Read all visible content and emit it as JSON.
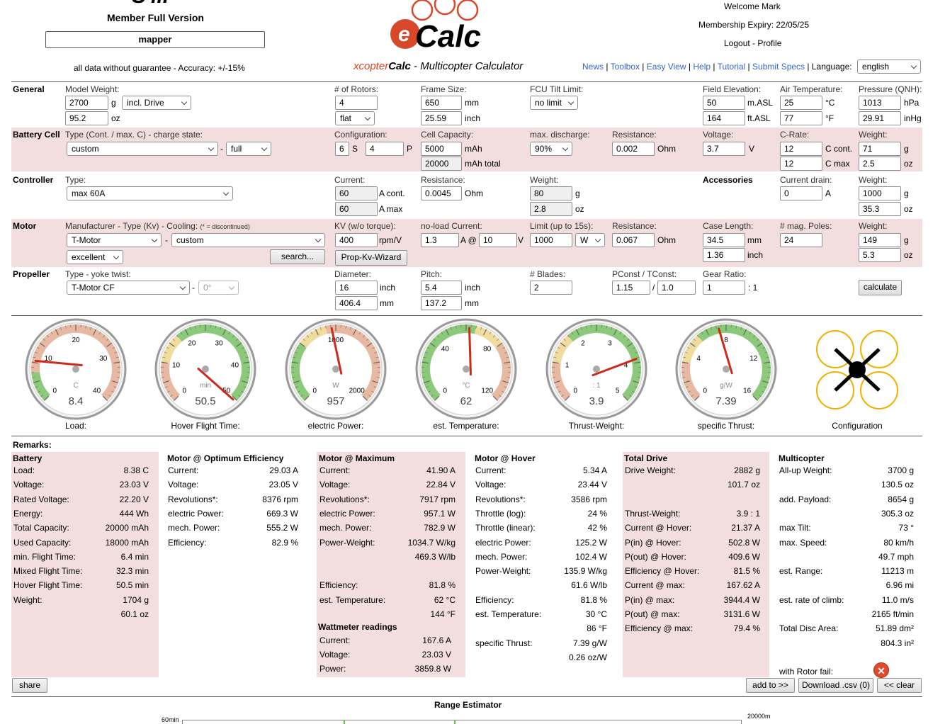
{
  "header": {
    "logo_text": "S'ill",
    "member": "Member Full Version",
    "username": "mapper",
    "disclaimer": "all data without guarantee - Accuracy: +/-15%",
    "brand_prefix": "xcopter",
    "brand_calc": "Calc",
    "brand_suffix": " - Multicopter Calculator",
    "welcome": "Welcome Mark",
    "membership": "Membership Expiry: 22/05/25",
    "logout": "Logout",
    "sep": " - ",
    "profile": "Profile",
    "links": [
      "News",
      "Toolbox",
      "Easy View",
      "Help",
      "Tutorial",
      "Submit Specs"
    ],
    "language_label": "Language:",
    "language": "english"
  },
  "general": {
    "title": "General",
    "weight_label": "Model Weight:",
    "weight_g": "2700",
    "unit_g": "g",
    "drive_select": "incl. Drive",
    "weight_oz": "95.2",
    "unit_oz": "oz",
    "rotors_label": "# of Rotors:",
    "rotors": "4",
    "layout": "flat",
    "frame_label": "Frame Size:",
    "frame_mm": "650",
    "unit_mm": "mm",
    "frame_inch": "25.59",
    "unit_inch": "inch",
    "tilt_label": "FCU Tilt Limit:",
    "tilt": "no limit",
    "elev_label": "Field Elevation:",
    "elev_m": "50",
    "unit_masl": "m.ASL",
    "elev_ft": "164",
    "unit_ftasl": "ft.ASL",
    "temp_label": "Air Temperature:",
    "temp_c": "25",
    "unit_c": "°C",
    "temp_f": "77",
    "unit_f": "°F",
    "qnh_label": "Pressure (QNH):",
    "qnh_hpa": "1013",
    "unit_hpa": "hPa",
    "qnh_inhg": "29.91",
    "unit_inhg": "inHg"
  },
  "battery": {
    "title": "Battery Cell",
    "type_label": "Type (Cont. / max. C) - charge state:",
    "type": "custom",
    "dash": "-",
    "charge": "full",
    "config_label": "Configuration:",
    "s": "6",
    "unit_s": "S",
    "p": "4",
    "unit_p": "P",
    "cap_label": "Cell Capacity:",
    "cap": "5000",
    "unit_mah": "mAh",
    "cap_total": "20000",
    "unit_mah_total": "mAh total",
    "disch_label": "max. discharge:",
    "disch": "90%",
    "res_label": "Resistance:",
    "res": "0.002",
    "unit_ohm": "Ohm",
    "volt_label": "Voltage:",
    "volt": "3.7",
    "unit_v": "V",
    "crate_label": "C-Rate:",
    "c_cont": "12",
    "unit_ccont": "C cont.",
    "c_max": "12",
    "unit_cmax": "C max",
    "weight_label": "Weight:",
    "w_g": "71",
    "unit_g": "g",
    "w_oz": "2.5",
    "unit_oz": "oz"
  },
  "controller": {
    "title": "Controller",
    "type_label": "Type:",
    "type": "max 60A",
    "cur_label": "Current:",
    "cur_cont": "60",
    "unit_acont": "A cont.",
    "cur_max": "60",
    "unit_amax": "A max",
    "res_label": "Resistance:",
    "res": "0.0045",
    "unit_ohm": "Ohm",
    "weight_label": "Weight:",
    "w_g": "80",
    "unit_g": "g",
    "w_oz": "2.8",
    "unit_oz": "oz",
    "acc_title": "Accessories",
    "drain_label": "Current drain:",
    "drain": "0",
    "unit_a": "A",
    "acc_w_label": "Weight:",
    "acc_w_g": "1000",
    "acc_unit_g": "g",
    "acc_w_oz": "35.3",
    "acc_unit_oz": "oz"
  },
  "motor": {
    "title": "Motor",
    "mfr_label": "Manufacturer - Type (Kv) - Cooling:",
    "mfr_note": "(* = discontinued)",
    "mfr": "T-Motor",
    "dash": "-",
    "type": "custom",
    "cooling": "excellent",
    "search": "search...",
    "kv_label": "KV (w/o torque):",
    "kv": "400",
    "unit_rpmv": "rpm/V",
    "wizard": "Prop-Kv-Wizard",
    "nl_label": "no-load Current:",
    "nl_a": "1.3",
    "unit_a_at": "A @",
    "nl_v": "10",
    "unit_v": "V",
    "limit_label": "Limit (up to 15s):",
    "limit": "1000",
    "limit_unit": "W",
    "res_label": "Resistance:",
    "res": "0.067",
    "unit_ohm": "Ohm",
    "case_label": "Case Length:",
    "case_mm": "34.5",
    "unit_mm": "mm",
    "case_inch": "1.36",
    "unit_inch": "inch",
    "poles_label": "# mag. Poles:",
    "poles": "24",
    "weight_label": "Weight:",
    "w_g": "149",
    "unit_g": "g",
    "w_oz": "5.3",
    "unit_oz": "oz"
  },
  "propeller": {
    "title": "Propeller",
    "type_label": "Type - yoke twist:",
    "type": "T-Motor CF",
    "dash": "-",
    "twist": "0°",
    "dia_label": "Diameter:",
    "dia_in": "16",
    "unit_inch": "inch",
    "dia_mm": "406.4",
    "unit_mm": "mm",
    "pitch_label": "Pitch:",
    "pitch_in": "5.4",
    "unit_pinch": "inch",
    "pitch_mm": "137.2",
    "unit_pmm": "mm",
    "blades_label": "# Blades:",
    "blades": "2",
    "pconst_label": "PConst / TConst:",
    "pconst": "1.15",
    "slash": "/",
    "tconst": "1.0",
    "gear_label": "Gear Ratio:",
    "gear": "1",
    "gear_unit": ": 1",
    "calculate": "calculate"
  },
  "gauges": [
    {
      "label": "Load:",
      "value": "8.4",
      "unit": "C",
      "ticks": [
        "0",
        "10",
        "20",
        "30",
        "40"
      ],
      "min": 0,
      "max": 40,
      "reading": 8.38,
      "zones": [
        [
          "#8cc97a",
          0,
          0.15
        ],
        [
          "#e8b9a2",
          0.15,
          1
        ]
      ]
    },
    {
      "label": "Hover Flight Time:",
      "value": "50.5",
      "unit": "min",
      "ticks": [
        "0",
        "10",
        "20",
        "30",
        "40",
        "50"
      ],
      "min": 0,
      "max": 50,
      "reading": 50.5,
      "zones": [
        [
          "#e8b9a2",
          0,
          0.2
        ],
        [
          "#f1dca0",
          0.2,
          0.35
        ],
        [
          "#8cc97a",
          0.35,
          1
        ]
      ]
    },
    {
      "label": "electric Power:",
      "value": "957",
      "unit": "W",
      "ticks": [
        "0",
        "1000",
        "2000"
      ],
      "min": 0,
      "max": 2000,
      "reading": 957,
      "zones": [
        [
          "#8cc97a",
          0,
          0.3
        ],
        [
          "#f1dca0",
          0.3,
          0.45
        ],
        [
          "#e8b9a2",
          0.45,
          1
        ]
      ]
    },
    {
      "label": "est. Temperature:",
      "value": "62",
      "unit": "°C",
      "ticks": [
        "0",
        "40",
        "80",
        "120"
      ],
      "min": 0,
      "max": 120,
      "reading": 62,
      "zones": [
        [
          "#8cc97a",
          0,
          0.55
        ],
        [
          "#f1dca0",
          0.55,
          0.7
        ],
        [
          "#e8b9a2",
          0.7,
          1
        ]
      ]
    },
    {
      "label": "Thrust-Weight:",
      "value": "3.9",
      "unit": ": 1",
      "ticks": [
        "0",
        "1",
        "2",
        "3",
        "4",
        "5"
      ],
      "min": 0,
      "max": 5,
      "reading": 3.9,
      "zones": [
        [
          "#e8b9a2",
          0,
          0.2
        ],
        [
          "#f1dca0",
          0.2,
          0.35
        ],
        [
          "#8cc97a",
          0.35,
          1
        ]
      ]
    },
    {
      "label": "specific Thrust:",
      "value": "7.39",
      "unit": "g/W",
      "ticks": [
        "0",
        "4",
        "8",
        "12",
        "16"
      ],
      "min": 0,
      "max": 16,
      "reading": 7.39,
      "zones": [
        [
          "#e8b9a2",
          0,
          0.2
        ],
        [
          "#f1dca0",
          0.2,
          0.35
        ],
        [
          "#8cc97a",
          0.35,
          1
        ]
      ]
    }
  ],
  "config_label": "Configuration",
  "remarks": "Remarks:",
  "results": {
    "battery": {
      "title": "Battery",
      "rows": [
        [
          "Load:",
          "8.38 C"
        ],
        [
          "Voltage:",
          "23.03 V"
        ],
        [
          "Rated Voltage:",
          "22.20 V"
        ],
        [
          "Energy:",
          "444 Wh"
        ],
        [
          "Total Capacity:",
          "20000 mAh"
        ],
        [
          "Used Capacity:",
          "18000 mAh"
        ],
        [
          "min. Flight Time:",
          "6.4 min"
        ],
        [
          "Mixed Flight Time:",
          "32.3 min"
        ],
        [
          "Hover Flight Time:",
          "50.5 min"
        ],
        [
          "Weight:",
          "1704 g"
        ],
        [
          "",
          "60.1 oz"
        ]
      ]
    },
    "opt": {
      "title": "Motor @ Optimum Efficiency",
      "rows": [
        [
          "Current:",
          "29.03 A"
        ],
        [
          "Voltage:",
          "23.05 V"
        ],
        [
          "Revolutions*:",
          "8376 rpm"
        ],
        [
          "electric Power:",
          "669.3 W"
        ],
        [
          "mech. Power:",
          "555.2 W"
        ],
        [
          "Efficiency:",
          "82.9 %"
        ]
      ]
    },
    "max": {
      "title": "Motor @ Maximum",
      "rows": [
        [
          "Current:",
          "41.90 A"
        ],
        [
          "Voltage:",
          "22.84 V"
        ],
        [
          "Revolutions*:",
          "7917 rpm"
        ],
        [
          "electric Power:",
          "957.1 W"
        ],
        [
          "mech. Power:",
          "782.9 W"
        ],
        [
          "Power-Weight:",
          "1034.7 W/kg"
        ],
        [
          "",
          "469.3 W/lb"
        ],
        [
          "Efficiency:",
          "81.8 %"
        ],
        [
          "est. Temperature:",
          "62 °C"
        ],
        [
          "",
          "144 °F"
        ]
      ],
      "watt_title": "Wattmeter readings",
      "watt": [
        [
          "Current:",
          "167.6 A"
        ],
        [
          "Voltage:",
          "23.03 V"
        ],
        [
          "Power:",
          "3859.8 W"
        ]
      ]
    },
    "hover": {
      "title": "Motor @ Hover",
      "rows": [
        [
          "Current:",
          "5.34 A"
        ],
        [
          "Voltage:",
          "23.44 V"
        ],
        [
          "Revolutions*:",
          "3586 rpm"
        ],
        [
          "Throttle (log):",
          "24 %"
        ],
        [
          "Throttle (linear):",
          "42 %"
        ],
        [
          "electric Power:",
          "125.2 W"
        ],
        [
          "mech. Power:",
          "102.4 W"
        ],
        [
          "Power-Weight:",
          "135.9 W/kg"
        ],
        [
          "",
          "61.6 W/lb"
        ],
        [
          "Efficiency:",
          "81.8 %"
        ],
        [
          "est. Temperature:",
          "30 °C"
        ],
        [
          "",
          "86 °F"
        ],
        [
          "specific Thrust:",
          "7.39 g/W"
        ],
        [
          "",
          "0.26 oz/W"
        ]
      ]
    },
    "drive": {
      "title": "Total Drive",
      "rows": [
        [
          "Drive Weight:",
          "2882 g"
        ],
        [
          "",
          "101.7 oz"
        ],
        [
          "Thrust-Weight:",
          "3.9 : 1"
        ],
        [
          "Current @ Hover:",
          "21.37 A"
        ],
        [
          "P(in) @ Hover:",
          "502.8 W"
        ],
        [
          "P(out) @ Hover:",
          "409.6 W"
        ],
        [
          "Efficiency @ Hover:",
          "81.5 %"
        ],
        [
          "Current @ max:",
          "167.62 A"
        ],
        [
          "P(in) @ max:",
          "3944.4 W"
        ],
        [
          "P(out) @ max:",
          "3131.6 W"
        ],
        [
          "Efficiency @ max:",
          "79.4 %"
        ]
      ]
    },
    "multi": {
      "title": "Multicopter",
      "rows": [
        [
          "All-up Weight:",
          "3700 g"
        ],
        [
          "",
          "130.5 oz"
        ],
        [
          "add. Payload:",
          "8654 g"
        ],
        [
          "",
          "305.3 oz"
        ],
        [
          "max Tilt:",
          "73 °"
        ],
        [
          "max. Speed:",
          "80 km/h"
        ],
        [
          "",
          "49.7 mph"
        ],
        [
          "est. Range:",
          "11213 m"
        ],
        [
          "",
          "6.96 mi"
        ],
        [
          "est. rate of climb:",
          "11.0 m/s"
        ],
        [
          "",
          "2165 ft/min"
        ],
        [
          "Total Disc Area:",
          "51.89 dm²"
        ],
        [
          "",
          "804.3 in²"
        ],
        [
          "with Rotor fail:",
          ""
        ]
      ]
    }
  },
  "actions": {
    "share": "share",
    "add": "add to >>",
    "download": "Download .csv (0)",
    "clear": "<< clear"
  },
  "range": {
    "title": "Range Estimator",
    "y_label": "60min",
    "y2_label": "20000m"
  }
}
